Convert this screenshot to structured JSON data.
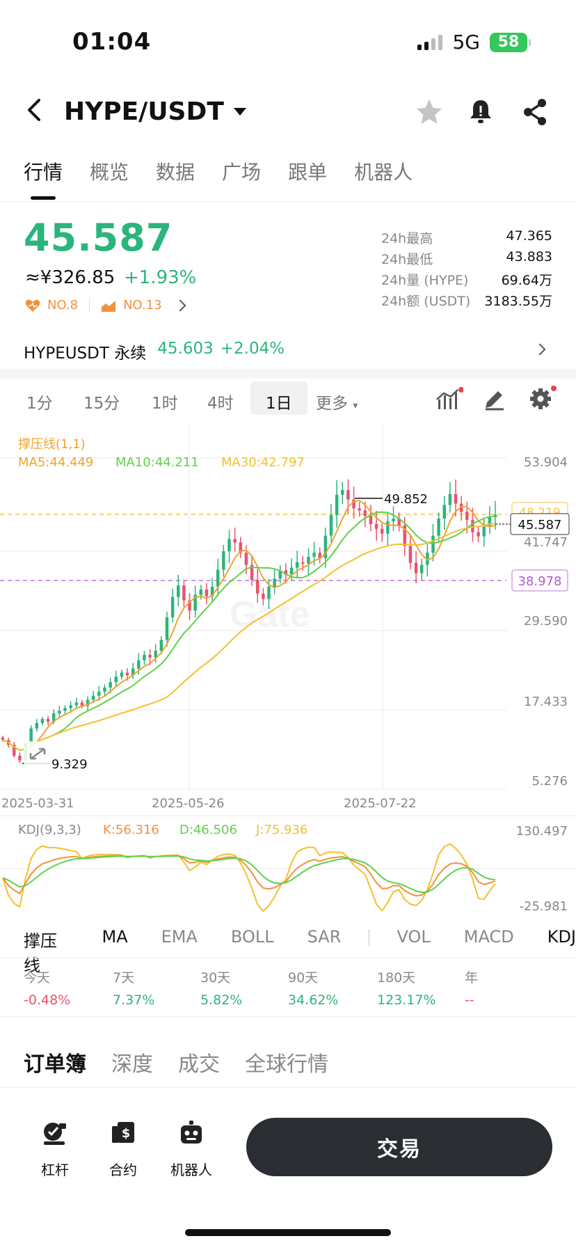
{
  "status_bar": {
    "time": "01:04",
    "network": "5G",
    "battery": "58"
  },
  "header": {
    "title": "HYPE/USDT"
  },
  "main_tabs": [
    "行情",
    "概览",
    "数据",
    "广场",
    "跟单",
    "机器人"
  ],
  "ticker": {
    "price": "45.587",
    "cny": "≈¥326.85",
    "change": "+1.93%",
    "rank1": "NO.8",
    "rank2": "NO.13",
    "stats": [
      {
        "label": "24h最高",
        "value": "47.365"
      },
      {
        "label": "24h最低",
        "value": "43.883"
      },
      {
        "label": "24h量 (HYPE)",
        "value": "69.64万"
      },
      {
        "label": "24h额 (USDT)",
        "value": "3183.55万"
      }
    ]
  },
  "perpetual": {
    "name": "HYPEUSDT 永续",
    "price": "45.603",
    "change": "+2.04%"
  },
  "timeframes": [
    "1分",
    "15分",
    "1时",
    "4时",
    "1日",
    "更多"
  ],
  "chart": {
    "indicator_title": "撑压线(1,1)",
    "ma5": "MA5:44.449",
    "ma10": "MA10:44.211",
    "ma30": "MA30:42.797",
    "y_ticks": [
      "53.904",
      "41.747",
      "29.590",
      "17.433",
      "5.276"
    ],
    "x_ticks": [
      "2025-03-31",
      "2025-05-26",
      "2025-07-22"
    ],
    "high_marker": "49.852",
    "low_marker": "9.329",
    "current_price_tag": "45.587",
    "resistance_tag": "48.219",
    "support_tag": "38.978",
    "kdj_title": "KDJ(9,3,3)",
    "kdj_k": "K:56.316",
    "kdj_d": "D:46.506",
    "kdj_j": "J:75.936",
    "kdj_top": "130.497",
    "kdj_bottom": "-25.981",
    "colors": {
      "up": "#2bb57b",
      "down": "#e9536b",
      "ma5": "#f0a32e",
      "ma10": "#5fd24a",
      "ma30": "#f2c12c"
    }
  },
  "chart_data": {
    "type": "candlestick",
    "title": "",
    "x_ticks": [
      "2025-03-31",
      "2025-05-26",
      "2025-07-22"
    ],
    "ylim": [
      5.276,
      53.904
    ],
    "y_ticks": [
      53.904,
      41.747,
      29.59,
      17.433,
      5.276
    ],
    "close_trend": [
      12.5,
      11.8,
      10.2,
      9.5,
      12.0,
      14.2,
      15.0,
      15.6,
      15.2,
      16.4,
      16.8,
      17.2,
      17.6,
      18.0,
      17.5,
      18.4,
      19.0,
      19.6,
      20.2,
      21.0,
      21.8,
      22.4,
      22.0,
      23.0,
      24.2,
      25.0,
      24.6,
      25.6,
      27.2,
      30.5,
      33.5,
      35.2,
      33.0,
      31.5,
      33.8,
      34.6,
      33.6,
      35.0,
      37.5,
      40.2,
      42.0,
      41.5,
      40.0,
      38.2,
      36.0,
      34.0,
      33.2,
      35.0,
      36.2,
      37.4,
      36.8,
      37.8,
      38.6,
      38.4,
      39.4,
      40.0,
      39.2,
      42.5,
      45.5,
      48.5,
      49.2,
      47.8,
      46.5,
      46.2,
      45.4,
      44.2,
      43.5,
      42.8,
      44.6,
      45.0,
      44.0,
      41.0,
      38.5,
      37.0,
      38.2,
      40.0,
      42.5,
      45.0,
      47.0,
      48.6,
      47.2,
      46.0,
      44.8,
      43.0,
      42.4,
      43.8,
      45.2,
      45.587
    ],
    "high_label": 49.852,
    "low_label": 9.329,
    "support": 38.978,
    "resistance": 48.219
  },
  "indicator_tabs": [
    "撑压线",
    "MA",
    "EMA",
    "BOLL",
    "SAR",
    "VOL",
    "MACD",
    "KDJ"
  ],
  "performance": [
    {
      "label": "今天",
      "value": "-0.48%",
      "dir": "down"
    },
    {
      "label": "7天",
      "value": "7.37%",
      "dir": "up"
    },
    {
      "label": "30天",
      "value": "5.82%",
      "dir": "up"
    },
    {
      "label": "90天",
      "value": "34.62%",
      "dir": "up"
    },
    {
      "label": "180天",
      "value": "123.17%",
      "dir": "up"
    },
    {
      "label": "年",
      "value": "--",
      "dir": "down"
    }
  ],
  "orderbook_tabs": [
    "订单簿",
    "深度",
    "成交",
    "全球行情"
  ],
  "bottom_bar": {
    "leverage": "杠杆",
    "contract": "合约",
    "bot": "机器人",
    "trade": "交易"
  }
}
